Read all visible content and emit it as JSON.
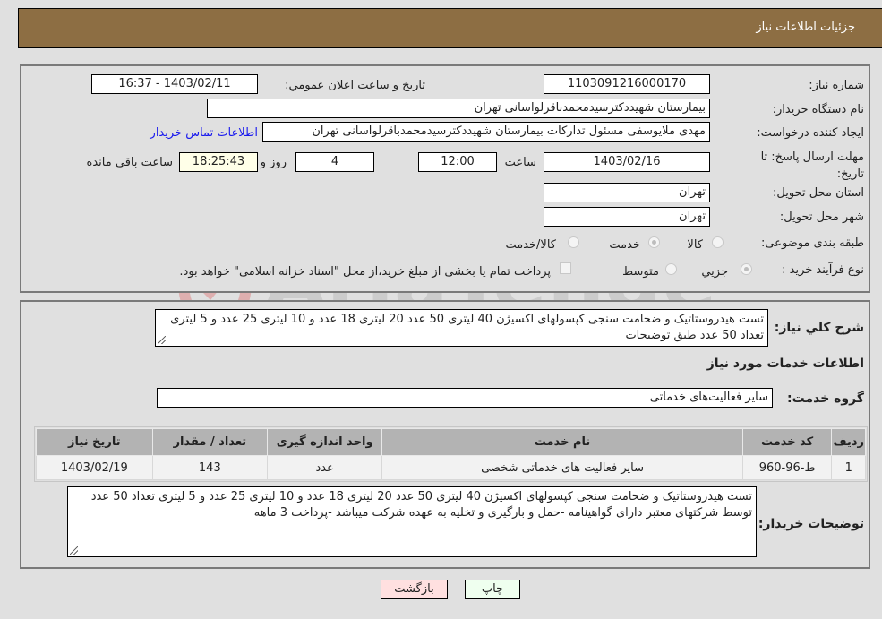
{
  "header": {
    "title": "جزئیات اطلاعات نیاز"
  },
  "details": {
    "need_number_label": "شماره نیاز:",
    "need_number": "1103091216000170",
    "announce_label": "تاریخ و ساعت اعلان عمومي:",
    "announce_value": "1403/02/11 - 16:37",
    "buyer_org_label": "نام دستگاه خریدار:",
    "buyer_org": "بیمارستان شهیددکترسیدمحمدباقرلواسانی تهران",
    "creator_label": "ایجاد کننده درخواست:",
    "creator": "مهدی ملایوسفی مسئول تدارکات بیمارستان شهیددکترسیدمحمدباقرلواسانی تهران",
    "contact_link": "اطلاعات تماس خریدار",
    "deadline_label": "مهلت ارسال پاسخ: تا تاریخ:",
    "deadline_date": "1403/02/16",
    "time_label": "ساعت",
    "deadline_time": "12:00",
    "days_value": "4",
    "days_label": "روز و",
    "remaining_time": "18:25:43",
    "remaining_label": "ساعت باقي مانده",
    "province_label": "استان محل تحویل:",
    "province": "تهران",
    "city_label": "شهر محل تحویل:",
    "city": "تهران",
    "category_label": "طبقه بندی موضوعی:",
    "category_options": [
      {
        "label": "کالا",
        "selected": false
      },
      {
        "label": "خدمت",
        "selected": true
      },
      {
        "label": "کالا/خدمت",
        "selected": false
      }
    ],
    "process_label": "نوع فرآیند خرید :",
    "process_options": [
      {
        "label": "جزيي",
        "selected": true
      },
      {
        "label": "متوسط",
        "selected": false
      }
    ],
    "payment_checkbox_label": "پرداخت تمام یا بخشی از مبلغ خرید،از محل \"اسناد خزانه اسلامی\" خواهد بود."
  },
  "summary": {
    "label": "شرح کلي نياز:",
    "text": "تست هیدروستاتیک و ضخامت سنجی کپسولهای اکسیژن 40 لیتری 50 عدد 20 لیتری 18 عدد و 10 لیتری 25 عدد و 5 لیتری تعداد 50 عدد طبق توضیحات"
  },
  "services": {
    "section_title": "اطلاعات خدمات مورد نیاز",
    "group_label": "گروه خدمت:",
    "group_value": "سایر فعالیت‌های خدماتی",
    "columns": [
      "ردیف",
      "کد خدمت",
      "نام خدمت",
      "واحد اندازه گیری",
      "تعداد / مقدار",
      "تاریخ نیاز"
    ],
    "rows": [
      [
        "1",
        "ط-96-960",
        "سایر فعالیت های خدماتی شخصی",
        "عدد",
        "143",
        "1403/02/19"
      ]
    ]
  },
  "buyer_notes": {
    "label": "توضیحات خریدار:",
    "text": "تست هیدروستاتیک و ضخامت سنجی کپسولهای اکسیژن 40 لیتری 50 عدد 20 لیتری 18 عدد و 10 لیتری 25 عدد و 5 لیتری تعداد 50 عدد توسط شرکتهای معتبر دارای گواهینامه -حمل و بارگیری و تخلیه به عهده شرکت میباشد -پرداخت 3 ماهه"
  },
  "buttons": {
    "print": "چاپ",
    "back": "بازگشت"
  },
  "watermark": {
    "text": "AriaTender.neT"
  },
  "colors": {
    "header": "#8d6e43",
    "back_button": "#ffe0e0",
    "print_button": "#efffef",
    "link": "#1a1aee"
  }
}
